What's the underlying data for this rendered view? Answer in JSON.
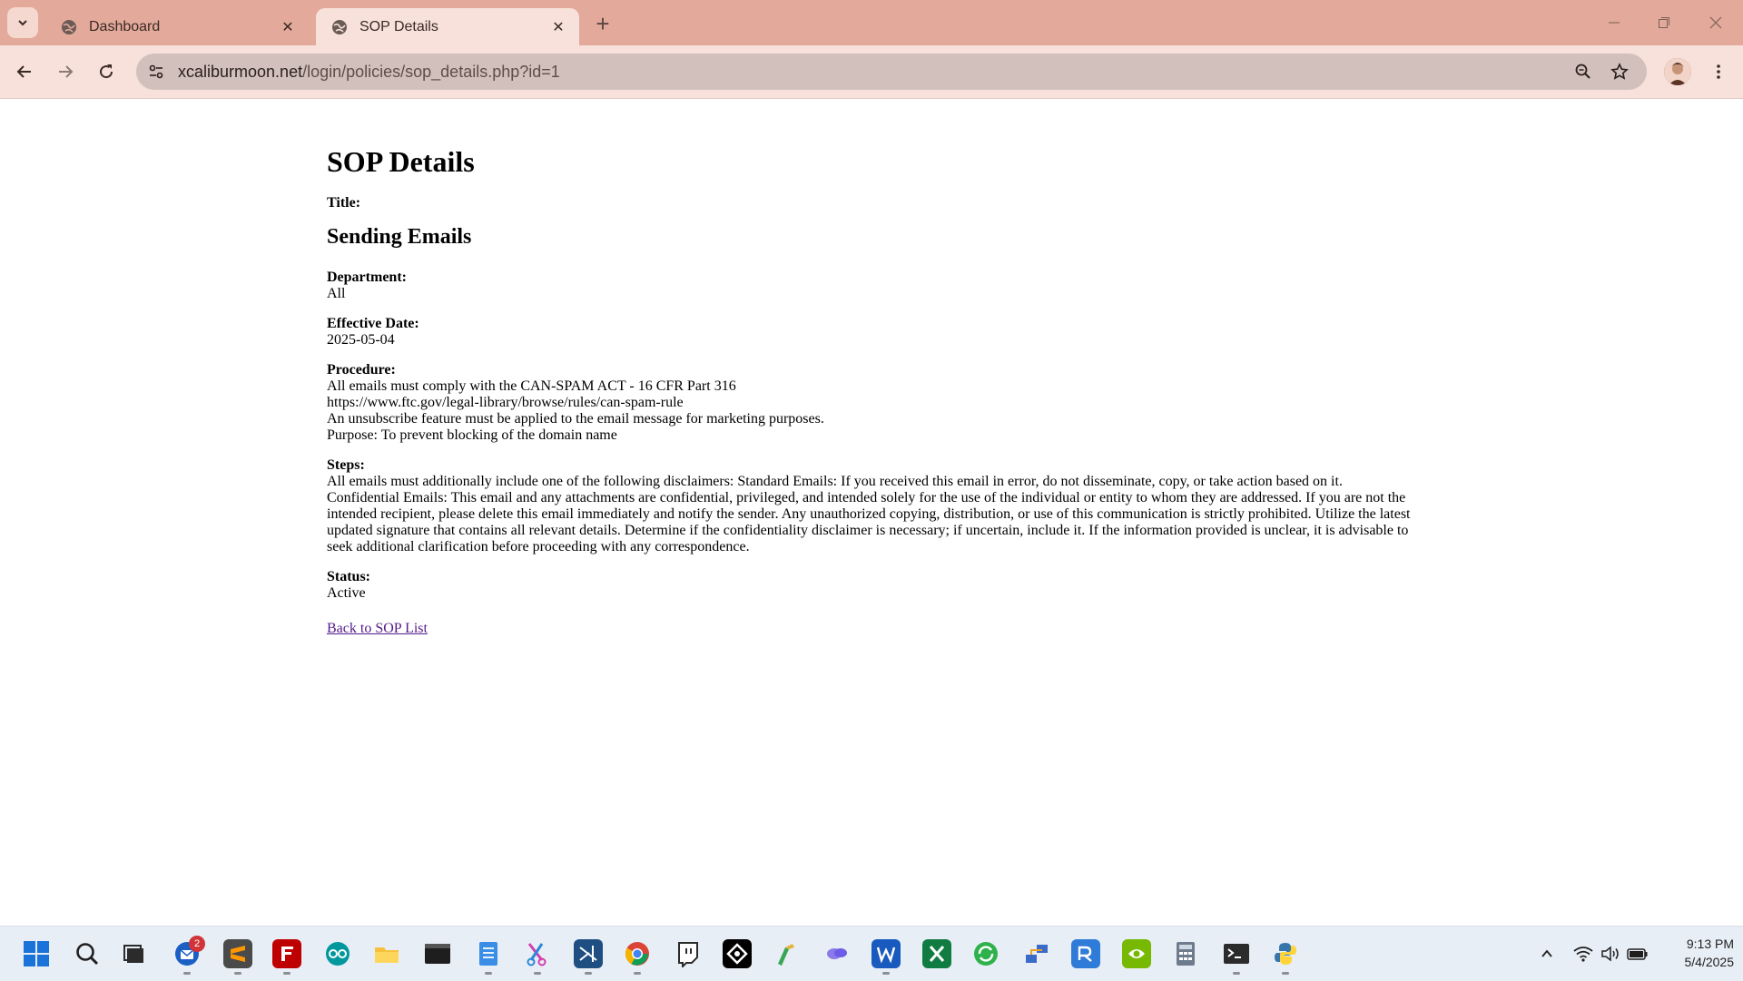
{
  "browser": {
    "tabs": [
      {
        "title": "Dashboard",
        "active": false
      },
      {
        "title": "SOP Details",
        "active": true
      }
    ],
    "url_host": "xcaliburmoon.net",
    "url_path": "/login/policies/sop_details.php?id=1"
  },
  "page": {
    "heading": "SOP Details",
    "title_label": "Title:",
    "title_value": "Sending Emails",
    "department_label": "Department:",
    "department_value": "All",
    "effective_date_label": "Effective Date:",
    "effective_date_value": "2025-05-04",
    "procedure_label": "Procedure:",
    "procedure_lines": [
      "All emails must comply with the CAN-SPAM ACT - 16 CFR Part 316",
      "https://www.ftc.gov/legal-library/browse/rules/can-spam-rule",
      "An unsubscribe feature must be applied to the email message for marketing purposes.",
      "Purpose: To prevent blocking of the domain name"
    ],
    "steps_label": "Steps:",
    "steps_lines": [
      "All emails must additionally include one of the following disclaimers: Standard Emails: If you received this email in error, do not disseminate, copy, or take action based on it.",
      "Confidential Emails: This email and any attachments are confidential, privileged, and intended solely for the use of the individual or entity to whom they are addressed. If you are not the intended recipient, please delete this email immediately and notify the sender. Any unauthorized copying, distribution, or use of this communication is strictly prohibited. Utilize the latest updated signature that contains all relevant details. Determine if the confidentiality disclaimer is necessary; if uncertain, include it. If the information provided is unclear, it is advisable to seek additional clarification before proceeding with any correspondence."
    ],
    "status_label": "Status:",
    "status_value": "Active",
    "back_link": "Back to SOP List"
  },
  "taskbar": {
    "apps": [
      "start-icon",
      "search-icon",
      "task-view-icon",
      "thunderbird-icon",
      "sublime-text-icon",
      "filezilla-icon",
      "arduino-icon",
      "file-explorer-icon",
      "terminal-icon",
      "notepad-icon",
      "snipping-tool-icon",
      "visual-studio-icon",
      "chrome-icon",
      "twitch-icon",
      "inkscape-icon",
      "paint-icon",
      "copilot-icon",
      "word-icon",
      "excel-icon",
      "sync-icon",
      "network-icon",
      "remote-desktop-icon",
      "nvidia-icon",
      "calculator-icon",
      "powershell-icon",
      "python-icon"
    ],
    "mail_badge": "2",
    "time": "9:13 PM",
    "date": "5/4/2025"
  }
}
